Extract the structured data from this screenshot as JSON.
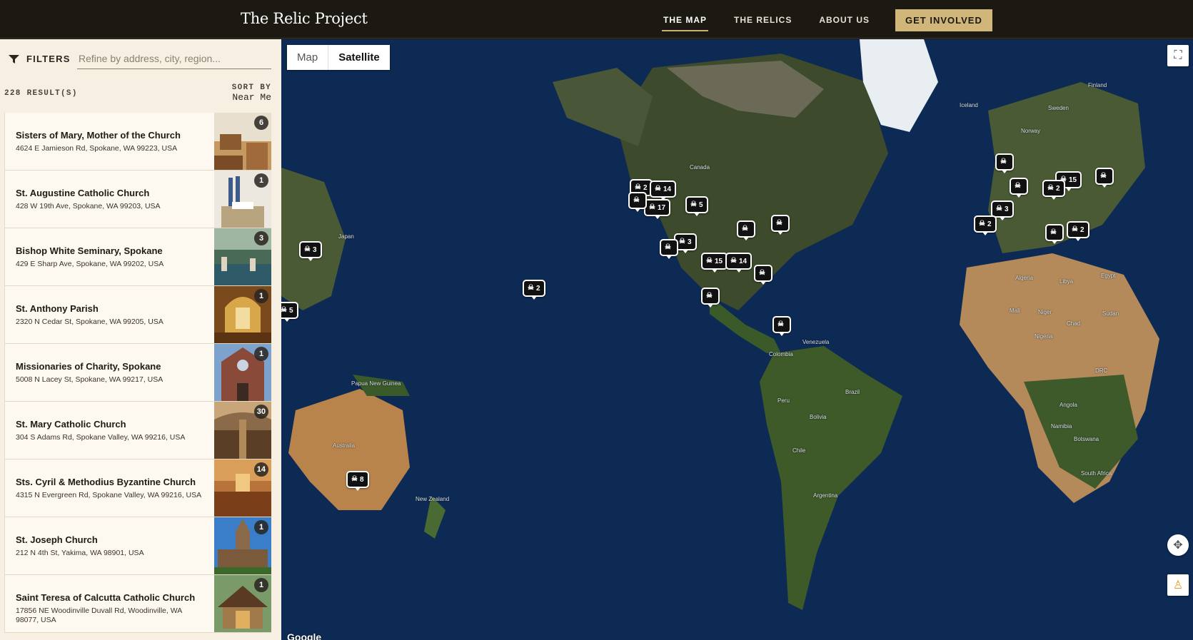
{
  "header": {
    "brand": "The Relic Project",
    "nav": [
      "THE MAP",
      "THE RELICS",
      "ABOUT US"
    ],
    "cta": "GET INVOLVED"
  },
  "sidebar": {
    "filters_label": "FILTERS",
    "search_placeholder": "Refine by address, city, region...",
    "results_count": "228 RESULT(S)",
    "sort_label": "SORT BY",
    "sort_value": "Near Me",
    "items": [
      {
        "name": "Sisters of Mary, Mother of the Church",
        "address": "4624 E Jamieson Rd, Spokane, WA 99223, USA",
        "count": "6"
      },
      {
        "name": "St. Augustine Catholic Church",
        "address": "428 W 19th Ave, Spokane, WA 99203, USA",
        "count": "1"
      },
      {
        "name": "Bishop White Seminary, Spokane",
        "address": "429 E Sharp Ave, Spokane, WA 99202, USA",
        "count": "3"
      },
      {
        "name": "St. Anthony Parish",
        "address": "2320 N Cedar St, Spokane, WA 99205, USA",
        "count": "1"
      },
      {
        "name": "Missionaries of Charity, Spokane",
        "address": "5008 N Lacey St, Spokane, WA 99217, USA",
        "count": "1"
      },
      {
        "name": "St. Mary Catholic Church",
        "address": "304 S Adams Rd, Spokane Valley, WA 99216, USA",
        "count": "30"
      },
      {
        "name": "Sts. Cyril & Methodius Byzantine Church",
        "address": "4315 N Evergreen Rd, Spokane Valley, WA 99216, USA",
        "count": "14"
      },
      {
        "name": "St. Joseph Church",
        "address": "212 N 4th St, Yakima, WA 98901, USA",
        "count": "1"
      },
      {
        "name": "Saint Teresa of Calcutta Catholic Church",
        "address": "17856 NE Woodinville Duvall Rd, Woodinville, WA 98077, USA",
        "count": "1"
      }
    ]
  },
  "map": {
    "toggle_map": "Map",
    "toggle_satellite": "Satellite",
    "attribution": "Google",
    "labels": [
      "Canada",
      "Japan",
      "Colombia",
      "Venezuela",
      "Peru",
      "Brazil",
      "Bolivia",
      "Chile",
      "Argentina",
      "Australia",
      "New Zealand",
      "Papua New Guinea",
      "Algeria",
      "Libya",
      "Mali",
      "Niger",
      "Chad",
      "Nigeria",
      "Sudan",
      "Egypt",
      "DRC",
      "Angola",
      "Namibia",
      "Botswana",
      "South Africa",
      "Iceland",
      "Sweden",
      "Finland",
      "Norway"
    ],
    "markers": [
      {
        "count": "3"
      },
      {
        "count": "5"
      },
      {
        "count": "2"
      },
      {
        "count": "8"
      },
      {
        "count": "2"
      },
      {
        "count": "14"
      },
      {
        "count": "17"
      },
      {
        "count": "5"
      },
      {
        "count": ""
      },
      {
        "count": "3"
      },
      {
        "count": ""
      },
      {
        "count": "15"
      },
      {
        "count": "14"
      },
      {
        "count": ""
      },
      {
        "count": ""
      },
      {
        "count": ""
      },
      {
        "count": "15"
      },
      {
        "count": "3"
      },
      {
        "count": "2"
      },
      {
        "count": "2"
      },
      {
        "count": ""
      },
      {
        "count": ""
      },
      {
        "count": ""
      },
      {
        "count": "2"
      },
      {
        "count": ""
      },
      {
        "count": ""
      },
      {
        "count": ""
      }
    ]
  }
}
